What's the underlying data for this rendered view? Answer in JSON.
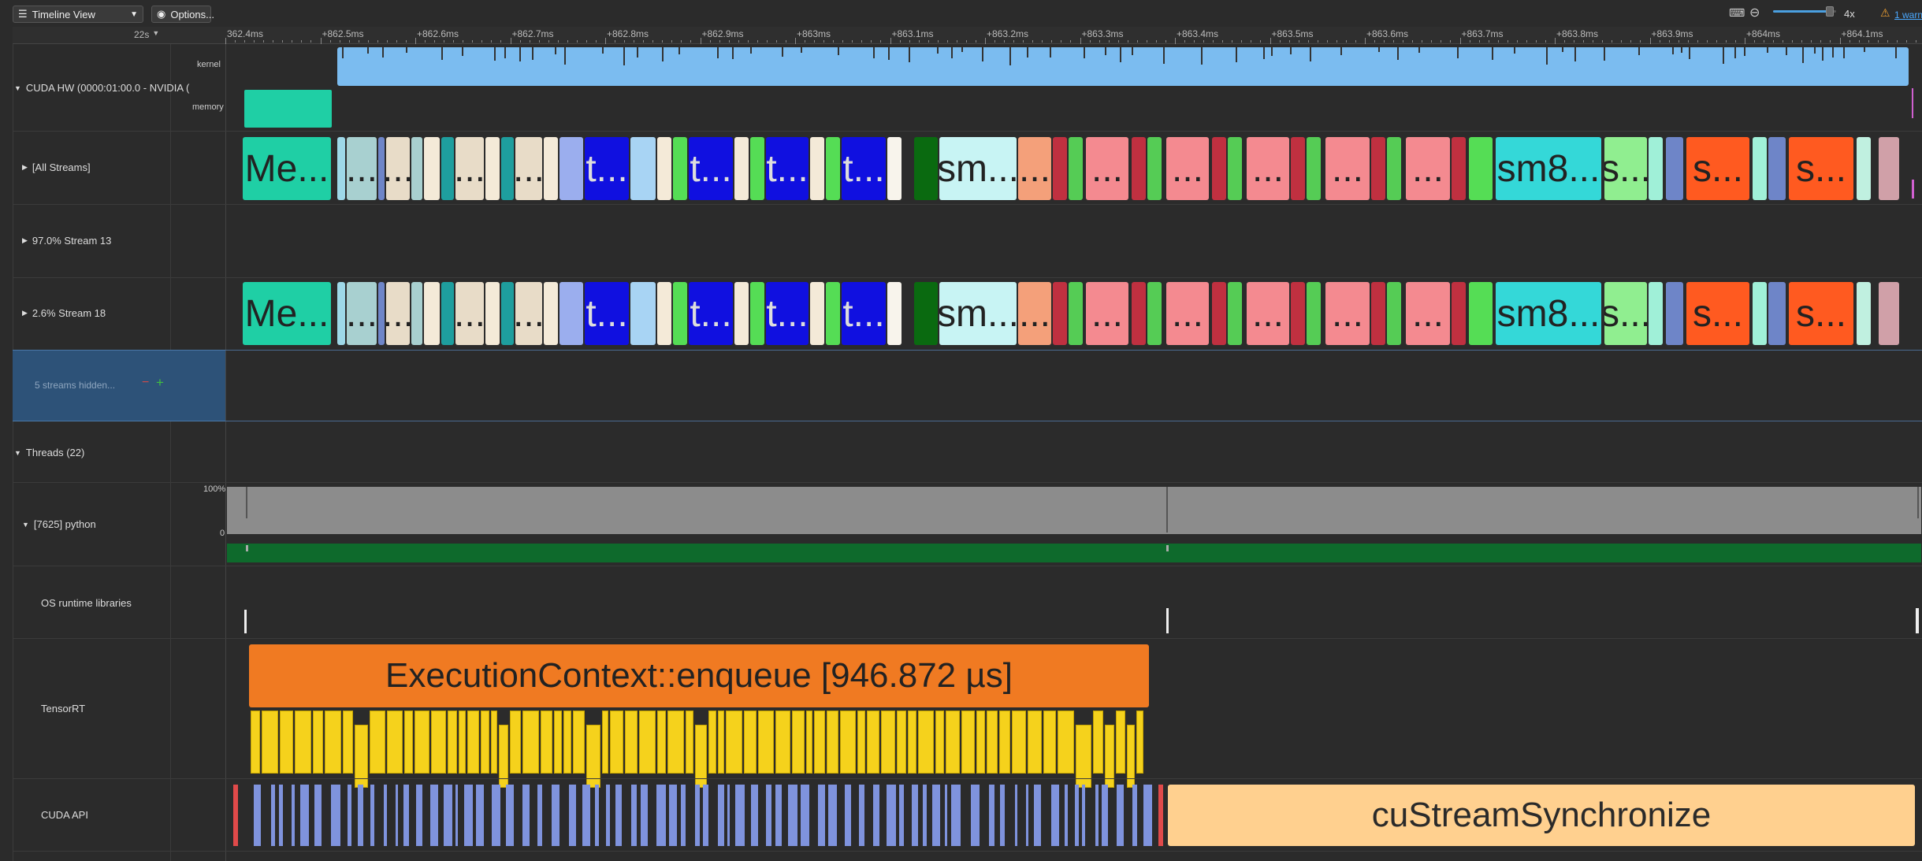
{
  "toolbar": {
    "view_label": "Timeline View",
    "options_label": "Options...",
    "zoom_level": "4x",
    "zoom_fraction": 0.9,
    "warnings_label": "1 warn"
  },
  "ruler": {
    "range_label": "22s",
    "ticks": [
      "362.4ms",
      "+862.5ms",
      "+862.6ms",
      "+862.7ms",
      "+862.8ms",
      "+862.9ms",
      "+863ms",
      "+863.1ms",
      "+863.2ms",
      "+863.3ms",
      "+863.4ms",
      "+863.5ms",
      "+863.6ms",
      "+863.7ms",
      "+863.8ms",
      "+863.9ms",
      "+864ms",
      "+864.1ms"
    ]
  },
  "rows": {
    "cuda_hw": "CUDA HW (0000:01:00.0 - NVIDIA (",
    "kernel": "kernel",
    "memory": "memory",
    "all_streams": "[All Streams]",
    "stream13": "97.0% Stream 13",
    "stream18": "2.6% Stream 18",
    "hidden": "5 streams hidden...",
    "threads": "Threads (22)",
    "python": "[7625] python",
    "cpu_max": "100%",
    "cpu_min": "0",
    "os_runtime": "OS runtime libraries",
    "tensorrt": "TensorRT",
    "cuda_api": "CUDA API"
  },
  "stream_labels": [
    "Me...",
    "...",
    "...",
    "...",
    "...",
    "t...",
    "t...",
    "t...",
    "t...",
    "sm...",
    "...",
    "...",
    "...",
    "...",
    "...",
    "...",
    "sm8...",
    "s...",
    "s...",
    "s..."
  ],
  "tensorrt_range": "ExecutionContext::enqueue [946.872 µs]",
  "cuda_sync": "cuStreamSynchronize",
  "colors": {
    "kernel": "#7bbcf0",
    "memory": "#1fcfa5",
    "enqueue": "#f07a22",
    "trt_ops": "#f5d21c",
    "cuda_api": "#7f93dd",
    "sync": "#ffd08f",
    "hidden_bg": "#2d5278"
  }
}
